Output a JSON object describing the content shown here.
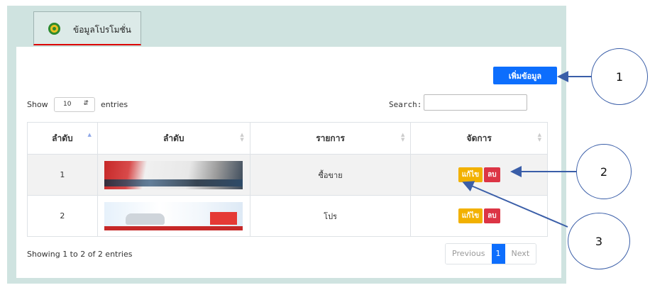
{
  "tab": {
    "icon": "percent-badge-icon",
    "label": "ข้อมูลโปรโมชั่น"
  },
  "add_button": "เพิ่มข้อมูล",
  "length": {
    "show": "Show",
    "value": "10",
    "entries": "entries"
  },
  "search": {
    "label": "Search:",
    "value": ""
  },
  "table": {
    "headers": [
      "ลำดับ",
      "ลำดับ",
      "รายการ",
      "จัดการ"
    ],
    "rows": [
      {
        "no": "1",
        "image": "promotion-banner-1",
        "item": "ซื้อขาย",
        "edit": "แก้ไข",
        "delete": "ลบ"
      },
      {
        "no": "2",
        "image": "promotion-banner-2",
        "item": "โปร",
        "edit": "แก้ไข",
        "delete": "ลบ"
      }
    ]
  },
  "info": "Showing 1 to 2 of 2 entries",
  "pagination": {
    "previous": "Previous",
    "page": "1",
    "next": "Next"
  },
  "callouts": [
    "1",
    "2",
    "3"
  ],
  "colors": {
    "primary": "#0d6efd",
    "warning": "#f2b100",
    "danger": "#dc3545",
    "outer_bg": "#cfe3e0",
    "annotation": "#3a5ea8"
  }
}
